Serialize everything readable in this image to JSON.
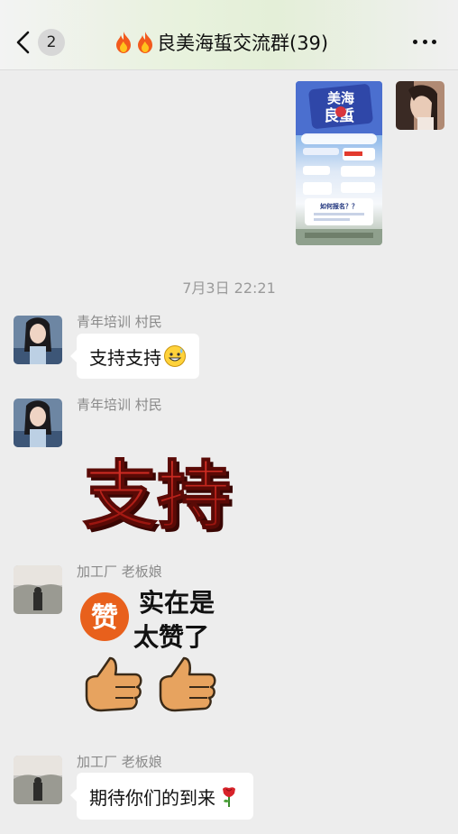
{
  "header": {
    "back_badge": "2",
    "title": "良美海蜇交流群(39)"
  },
  "poster": {
    "line1": "美海",
    "line2": "良蜇",
    "button": "如何报名？？"
  },
  "timestamp": "7月3日 22:21",
  "messages": [
    {
      "sender": "青年培训 村民",
      "text": "支持支持"
    },
    {
      "sender": "青年培训 村民",
      "sticker_text": "支持"
    },
    {
      "sender": "加工厂 老板娘",
      "sticker_badge": "赞",
      "sticker_line1": "实在是",
      "sticker_line2": "太赞了"
    },
    {
      "sender": "加工厂 老板娘",
      "text": "期待你们的到来"
    }
  ],
  "colors": {
    "accent_red": "#c61b14",
    "badge_orange": "#e8601c",
    "thumb": "#e7a35f"
  },
  "icons": [
    "back-chevron-icon",
    "flame-icon",
    "more-icon",
    "grinning-sweat-emoji-icon",
    "rose-emoji-icon",
    "thumbs-up-icon"
  ]
}
